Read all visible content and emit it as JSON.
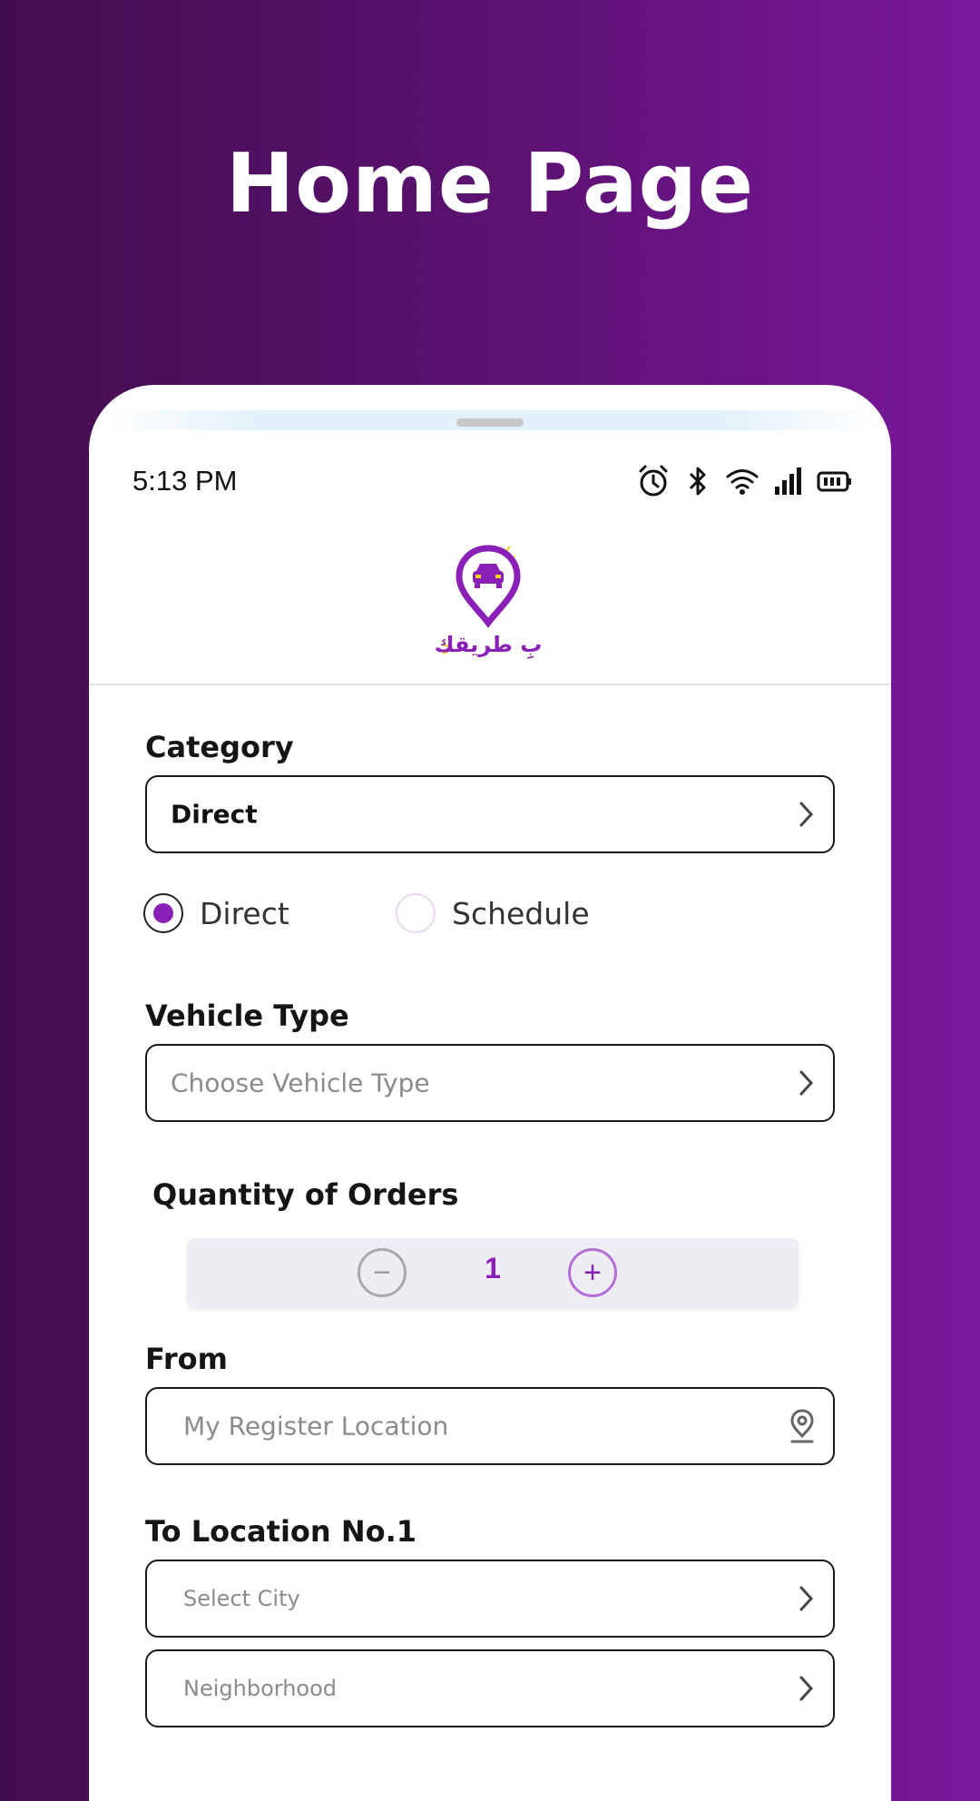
{
  "headline": "Home Page",
  "status_bar": {
    "time": "5:13 PM",
    "icons": [
      "alarm-icon",
      "bluetooth-icon",
      "wifi-icon",
      "signal-icon",
      "battery-icon"
    ]
  },
  "app": {
    "logo_icon": "car-location-pin-logo",
    "logo_text": "بِ طريقك"
  },
  "form": {
    "category": {
      "label": "Category",
      "value": "Direct"
    },
    "order_mode": {
      "options": [
        {
          "label": "Direct",
          "selected": true
        },
        {
          "label": "Schedule",
          "selected": false
        }
      ]
    },
    "vehicle_type": {
      "label": "Vehicle Type",
      "placeholder": "Choose Vehicle Type"
    },
    "quantity": {
      "label": "Quantity of Orders",
      "value": "1",
      "minus_symbol": "−",
      "plus_symbol": "+"
    },
    "from": {
      "label": "From",
      "placeholder": "My Register Location"
    },
    "to_location": {
      "label": "To Location No.1",
      "city_placeholder": "Select City",
      "neighborhood_placeholder": "Neighborhood"
    }
  },
  "colors": {
    "accent": "#8a20b8",
    "background_start": "#420d4e",
    "background_end": "#7a189c"
  }
}
